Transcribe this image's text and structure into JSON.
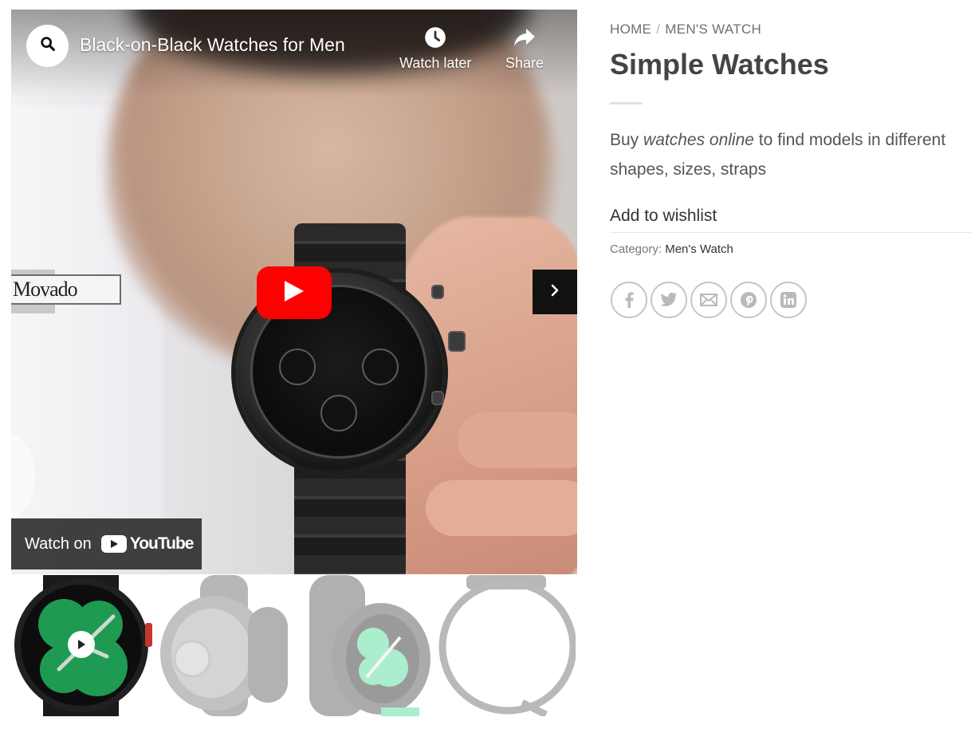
{
  "video": {
    "title": "Black-on-Black Watches for Men",
    "watch_later_label": "Watch later",
    "share_label": "Share",
    "watch_on_label": "Watch on",
    "youtube_label": "YouTube",
    "sign_text": "Movado",
    "icons": {
      "channel": "search-icon",
      "later": "clock-icon",
      "share": "share-arrow-icon",
      "play": "play-icon",
      "next": "chevron-right-icon"
    }
  },
  "gallery": {
    "thumbnails": [
      {
        "name": "black-watch-with-green-face",
        "active": true,
        "has_video_badge": true
      },
      {
        "name": "watch-back-view",
        "active": false
      },
      {
        "name": "watch-side-view-mint-face",
        "active": false
      },
      {
        "name": "watch-strap-view",
        "active": false
      }
    ]
  },
  "product": {
    "breadcrumb": {
      "home": "HOME",
      "separator": "/",
      "category": "MEN'S WATCH"
    },
    "title": "Simple Watches",
    "description": {
      "prefix": "Buy ",
      "emphasis": "watches online",
      "suffix": " to find models in different shapes, sizes, straps"
    },
    "wishlist_label": "Add to wishlist",
    "category_label": "Category:",
    "category_value": "Men's Watch",
    "share_icons": [
      "facebook-icon",
      "twitter-icon",
      "email-icon",
      "pinterest-icon",
      "linkedin-icon"
    ]
  },
  "colors": {
    "youtube_red": "#ff0000",
    "title_text": "#444444",
    "body_text": "#555555",
    "muted": "#6f6f6f",
    "icon_border": "#c6c6c6",
    "watch_green": "#1f9a53"
  }
}
